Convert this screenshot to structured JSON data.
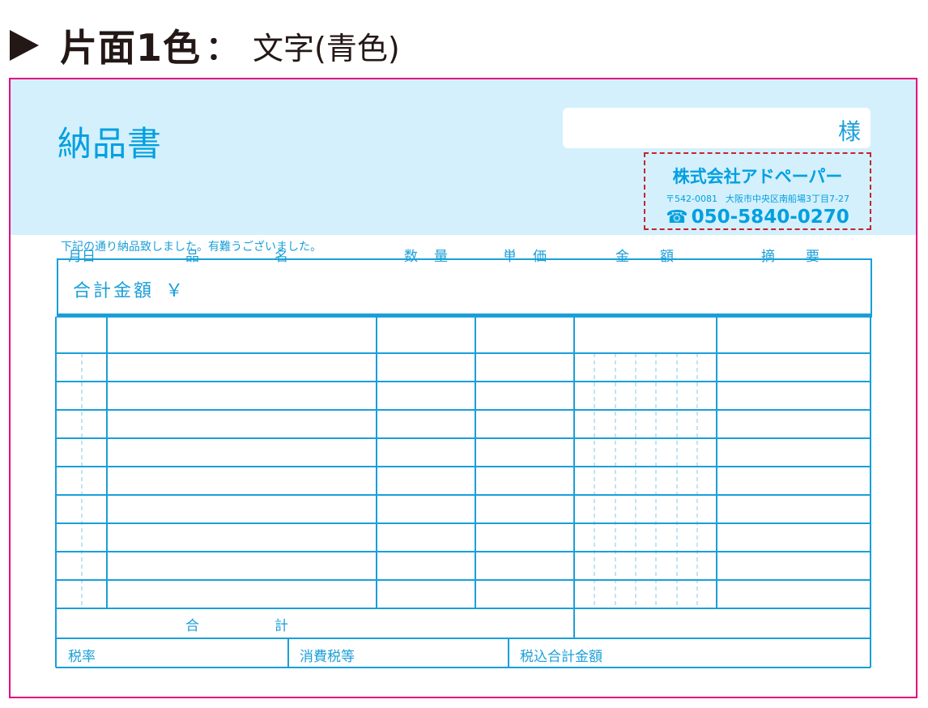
{
  "heading": {
    "main": "片面1色",
    "colon": "：",
    "sub": "文字(青色)"
  },
  "document": {
    "title": "納品書",
    "customer_suffix": "様",
    "company": {
      "name": "株式会社アドペーパー",
      "postal": "〒542-0081",
      "address": "大阪市中央区南船場3丁目7-27",
      "tel_icon": "phone-icon",
      "tel": "050-5840-0270"
    },
    "note": "下記の通り納品致しました。有難うございました。",
    "total_label": "合計金額",
    "yen_sign": "￥",
    "columns": {
      "date": "月日",
      "item_a": "品",
      "item_b": "名",
      "qty_a": "数",
      "qty_b": "量",
      "price_a": "単",
      "price_b": "価",
      "amount_a": "金",
      "amount_b": "額",
      "memo_a": "摘",
      "memo_b": "要"
    },
    "row_count": 9,
    "sum_a": "合",
    "sum_b": "計",
    "tax_rate": "税率",
    "consumption_tax": "消費税等",
    "tax_included_total": "税込合計金額"
  },
  "colors": {
    "line": "#1a9fd9",
    "band": "#d4f0fc",
    "border": "#e4007f",
    "dashed": "#c1272d"
  }
}
